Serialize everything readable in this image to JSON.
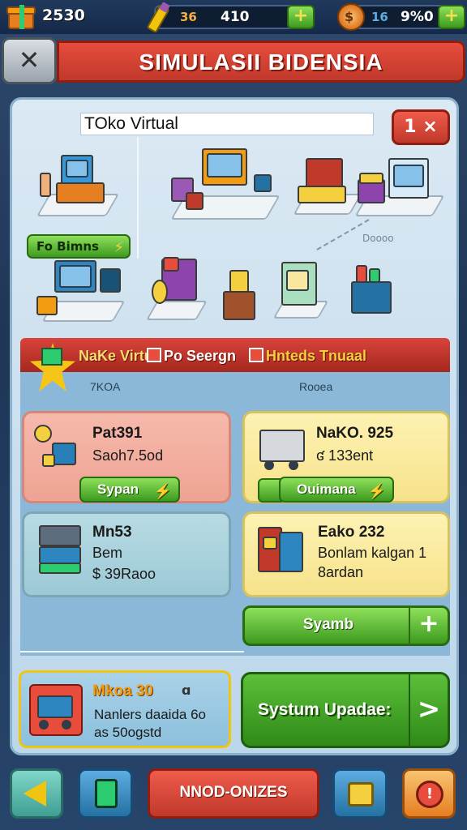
{
  "topbar": {
    "gift_coins": "2530",
    "resource1": {
      "label": "36",
      "value": "410",
      "plus": "+"
    },
    "resource2": {
      "label": "16",
      "value": "9%0",
      "plus": "+"
    },
    "coin_symbol": "$"
  },
  "header": {
    "title": "SIMULASII BIDENSIA",
    "back_icon": "back-arrow-icon"
  },
  "store": {
    "name_value": "TOko Virtual",
    "close_label": "1 ×",
    "green_pill_label": "Fo Bimns",
    "dash_label": "Doooo"
  },
  "section": {
    "tab1": "NaKe Virtul:",
    "tab2": "Po Seergn",
    "tab3": "Hnteds Tnuaal",
    "sub1": "7KOA",
    "sub2": "Rooea"
  },
  "cards": [
    {
      "name": "Pat391",
      "detail": "Saoh7.5od",
      "button": "Sypan"
    },
    {
      "name": "NaKO. 925",
      "detail": "ʛ 133ent",
      "button": "Ouimana"
    },
    {
      "name": "Mn53",
      "detail": "Bem",
      "detail2": "$ 39Raoo"
    },
    {
      "name": "Eako 232",
      "detail": "Bonlam kalgan 1",
      "detail2": "8ardan"
    }
  ],
  "actions": {
    "search_label": "Syamb",
    "search_plus": "+",
    "system_label": "Systum Upadae:",
    "system_chevron": ">"
  },
  "bottom_card": {
    "name": "Mkoa 30",
    "marker": "ɑ",
    "line1": "Nanlers daaida 6o",
    "line2": "as 50ogstd"
  },
  "nav": {
    "main_label": "NNOD-ONIZES",
    "alert_symbol": "!"
  },
  "colors": {
    "title_red": "#c0392b",
    "button_green": "#3d9a1f",
    "card_red": "#f6b9ab",
    "card_yellow": "#fdf2b3",
    "card_teal": "#b8dbe4"
  }
}
